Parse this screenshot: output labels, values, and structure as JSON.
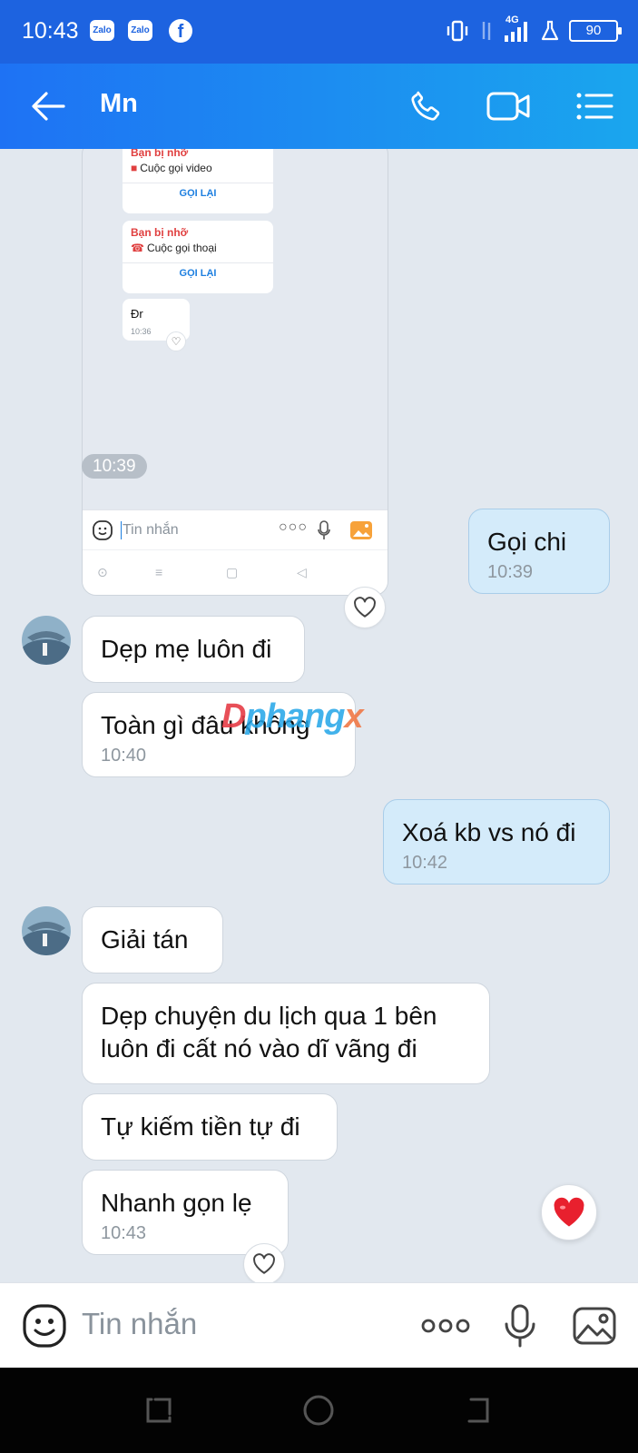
{
  "status_bar": {
    "time": "10:43",
    "app_badge_1": "Zalo",
    "app_badge_2": "Zalo",
    "network": "4G",
    "battery": "90"
  },
  "header": {
    "title": "Mn"
  },
  "screenshot": {
    "card1": {
      "title": "Bạn bị nhỡ",
      "subtitle": "Cuộc gọi video",
      "button": "GỌI LẠI"
    },
    "card2": {
      "title": "Bạn bị nhỡ",
      "subtitle": "Cuộc gọi thoại",
      "button": "GỌI LẠI"
    },
    "message": {
      "text": "Đr",
      "time": "10:36"
    },
    "input_placeholder": "Tin nhắn"
  },
  "time_divider": "10:39",
  "messages": [
    {
      "side": "sent",
      "text": "Gọi chi",
      "time": "10:39"
    },
    {
      "side": "received",
      "text": "Dẹp mẹ luôn đi"
    },
    {
      "side": "received",
      "text": "Toàn gì đâu không",
      "time": "10:40"
    },
    {
      "side": "sent",
      "text": "Xoá kb vs nó đi",
      "time": "10:42"
    },
    {
      "side": "received",
      "text": "Giải tán"
    },
    {
      "side": "received",
      "text": "Dẹp chuyện du lịch qua 1 bên\nluôn đi cất nó vào dĩ vãng đi"
    },
    {
      "side": "received",
      "text": "Tự kiếm tiền tự đi"
    },
    {
      "side": "received",
      "text": "Nhanh gọn lẹ",
      "time": "10:43"
    }
  ],
  "watermark": {
    "part1": "D",
    "part2": "phang",
    "part3": "x"
  },
  "input_bar": {
    "placeholder": "Tin nhắn"
  },
  "colors": {
    "header_start": "#1e72f4",
    "header_end": "#1aa6ee",
    "sent_bubble": "#d4ebfa",
    "received_bubble": "#ffffff",
    "heart": "#e8202e"
  }
}
